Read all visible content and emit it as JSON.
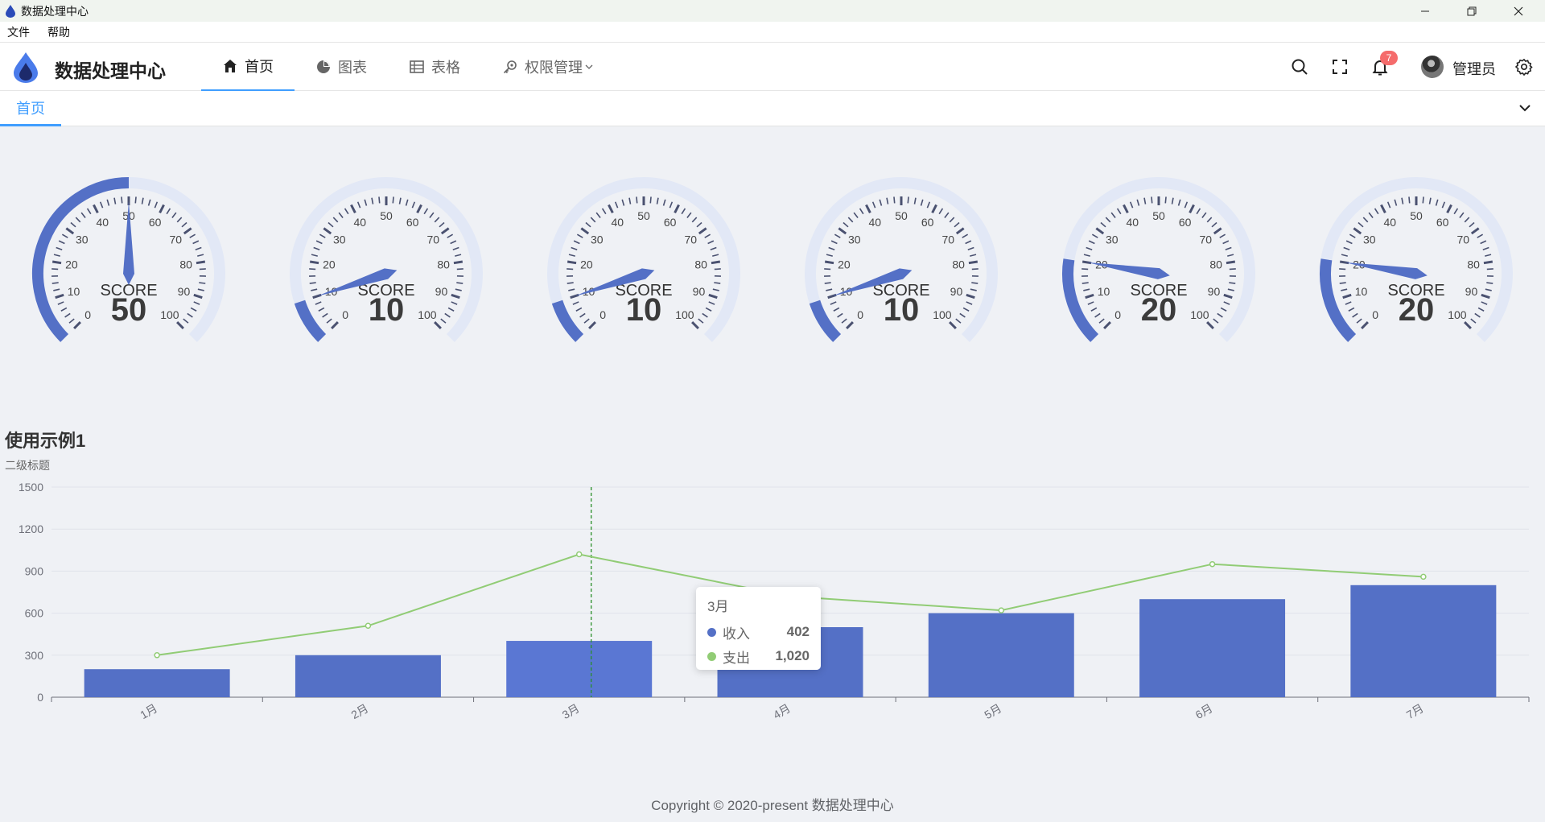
{
  "window": {
    "title": "数据处理中心"
  },
  "menubar": {
    "items": [
      "文件",
      "帮助"
    ]
  },
  "header": {
    "brand": "数据处理中心",
    "nav": [
      {
        "label": "首页",
        "icon": "home-icon",
        "active": true
      },
      {
        "label": "图表",
        "icon": "pie-chart-icon",
        "active": false
      },
      {
        "label": "表格",
        "icon": "table-icon",
        "active": false
      },
      {
        "label": "权限管理",
        "icon": "key-icon",
        "active": false
      }
    ],
    "notification_count": "7",
    "username": "管理员"
  },
  "tabs": {
    "active": "首页"
  },
  "gauges": [
    {
      "label": "SCORE",
      "value": 50
    },
    {
      "label": "SCORE",
      "value": 10
    },
    {
      "label": "SCORE",
      "value": 10
    },
    {
      "label": "SCORE",
      "value": 10
    },
    {
      "label": "SCORE",
      "value": 20
    },
    {
      "label": "SCORE",
      "value": 20
    }
  ],
  "gauge_ticks": [
    "0",
    "10",
    "20",
    "30",
    "40",
    "50",
    "60",
    "70",
    "80",
    "90",
    "100"
  ],
  "chart_data": {
    "type": "bar",
    "title": "使用示例1",
    "subtitle": "二级标题",
    "categories": [
      "1月",
      "2月",
      "3月",
      "4月",
      "5月",
      "6月",
      "7月"
    ],
    "series": [
      {
        "name": "收入",
        "type": "bar",
        "values": [
          200,
          300,
          402,
          500,
          600,
          700,
          800
        ],
        "color": "#5470c6"
      },
      {
        "name": "支出",
        "type": "line",
        "values": [
          300,
          510,
          1020,
          720,
          620,
          950,
          860
        ],
        "color": "#91cc75"
      }
    ],
    "yticks": [
      0,
      300,
      600,
      900,
      1200,
      1500
    ],
    "ylim": [
      0,
      1500
    ],
    "highlight_category": "3月"
  },
  "tooltip": {
    "title": "3月",
    "rows": [
      {
        "name": "收入",
        "value": "402",
        "color": "#5470c6"
      },
      {
        "name": "支出",
        "value": "1,020",
        "color": "#91cc75"
      }
    ]
  },
  "footer": {
    "text": "Copyright © 2020-present 数据处理中心"
  }
}
